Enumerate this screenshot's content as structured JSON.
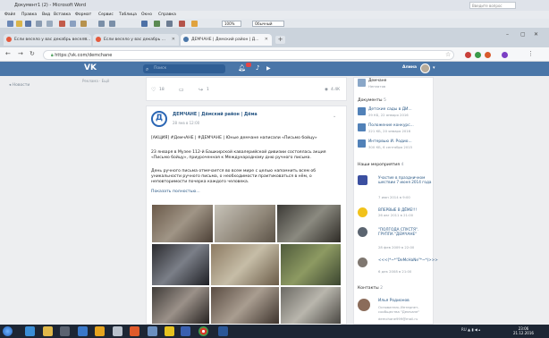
{
  "word": {
    "title": "Документ1 (2) - Microsoft Word",
    "search_placeholder": "Введите вопрос",
    "menu": [
      "Файл",
      "Правка",
      "Вид",
      "Вставка",
      "Формат",
      "Сервис",
      "Таблица",
      "Окно",
      "Справка"
    ],
    "zoom": "100%",
    "style": "Обычный"
  },
  "browser": {
    "tabs": [
      {
        "label": "Если весело у вас декабрь весело..."
      },
      {
        "label": "Если весело у вас декабрь ..."
      },
      {
        "label": "ДЕМЧАНЕ | Демский район | Д..."
      }
    ],
    "url": "https://vk.com/demchane"
  },
  "vk": {
    "logo": "VK",
    "search_placeholder": "Поиск",
    "user_name": "Алина"
  },
  "left_nav": {
    "item": "Новости"
  },
  "ads": {
    "label": "Реклама · Ещё"
  },
  "top_post": {
    "likes": "18",
    "reposts": "1",
    "views": "4.4K"
  },
  "post": {
    "logo_letter": "Д",
    "author": "ДЕМЧАНЕ | Дёмский район | Дёма",
    "date": "28 янв в 12:00",
    "tags": "[АКЦИЯ] #ДемчАНЕ | #ДЕМЧАНЕ | Юные демчане написали «Письмо бойцу»",
    "text1": "23 января в Музее 112-й Башкирской кавалерийской дивизии состоялась акция «Письмо бойцу», приуроченная к Международному дню ручного письма.",
    "text2": "День ручного письма отмечается во всем мире с целью напомнить всем об уникальности ручного письма, о необходимости практиковаться в нём, о неповторимости почерка каждого человека.",
    "more": "Показать полностью..."
  },
  "right": {
    "top_item": {
      "title": "Демчане",
      "sub": "Негматов"
    },
    "docs_header": "Документы",
    "docs_count": "5",
    "docs": [
      {
        "title": "Детские сады в ДИ...",
        "sub": "29 КБ, 22 января 2016"
      },
      {
        "title": "Положение конкурс...",
        "sub": "221 КБ, 20 января 2016"
      },
      {
        "title": "Интервью И. Родио...",
        "sub": "300 КБ, 6 сентября 2015"
      }
    ],
    "events_header": "Наши мероприятия",
    "events_count": "4",
    "events": [
      {
        "title": "Участие в праздничном шествии 7 июня 2014 года",
        "date": "7 июн 2014 в 9:00"
      },
      {
        "title": "ВПЕРВЫЕ В ДЁМЕ!!!",
        "date": "26 авг 2011 в 21:00"
      },
      {
        "title": "\"ПОЛГОДА СПУСТЯ\". ГРУППА \"ДЕМЧАНЕ\"",
        "date": "28 фев 2009 в 22:00"
      },
      {
        "title": "<<<(*~*\"DeMcHaNe\"*~*)>>>",
        "date": "6 дек 2008 в 21:00"
      }
    ],
    "contacts_header": "Контакты",
    "contacts_count": "2",
    "contact": {
      "name": "Илья Родионов",
      "role": "Основатель Интернет-сообщества \"Демчане\"",
      "email": "demchane999@mail.ru"
    }
  },
  "taskbar": {
    "tray": "RU ▲ ▮ ◀ ▴",
    "time": "23:06",
    "date": "21.12.2016"
  },
  "colors": {
    "vk_blue": "#4a76a8",
    "link": "#2a5885",
    "taskbar": "#1d2634"
  }
}
